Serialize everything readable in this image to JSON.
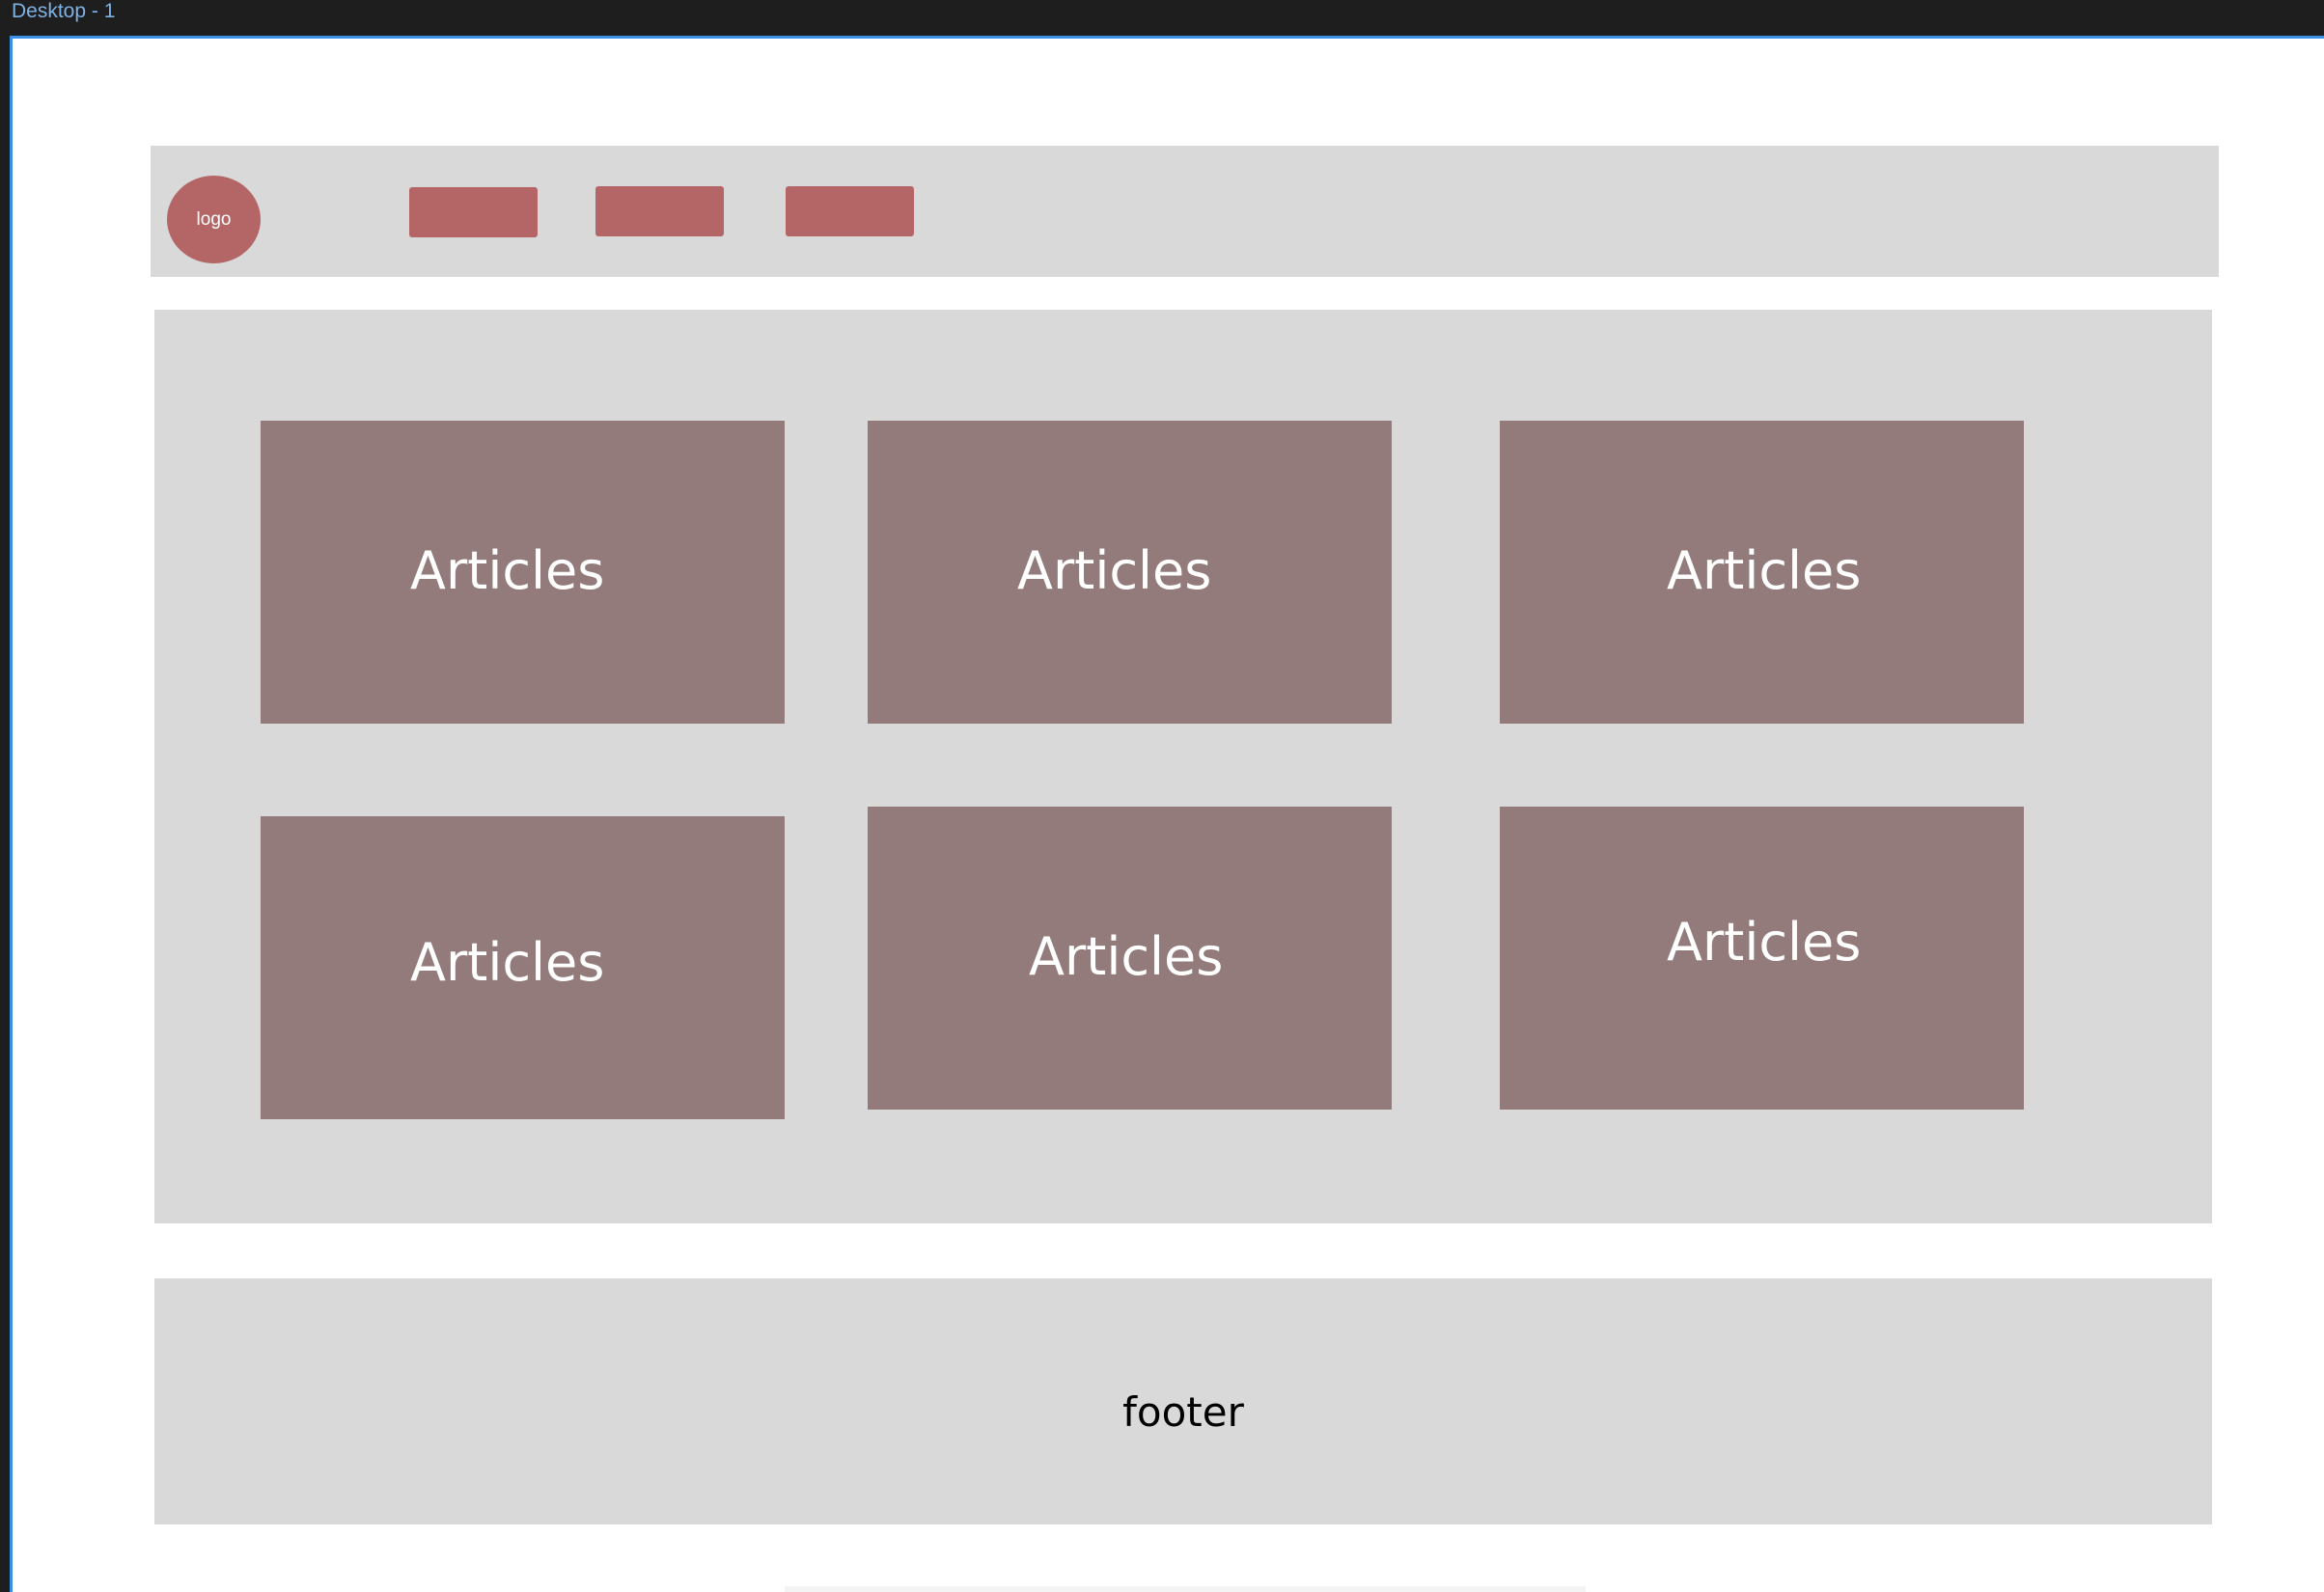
{
  "window": {
    "frame_label": "Desktop - 1"
  },
  "header": {
    "logo_label": "logo",
    "nav_items": [
      {
        "label": ""
      },
      {
        "label": ""
      },
      {
        "label": ""
      }
    ]
  },
  "main": {
    "cards": [
      {
        "label": "Articles"
      },
      {
        "label": "Articles"
      },
      {
        "label": "Articles"
      },
      {
        "label": "Articles"
      },
      {
        "label": "Articles"
      },
      {
        "label": "Articles"
      }
    ]
  },
  "footer": {
    "label": "footer"
  },
  "colors": {
    "header_bg": "#d9d9d9",
    "accent": "#b46666",
    "card_bg": "#937b7b",
    "selection": "#3a8fe6",
    "chrome_bg": "#1e1e1e"
  }
}
